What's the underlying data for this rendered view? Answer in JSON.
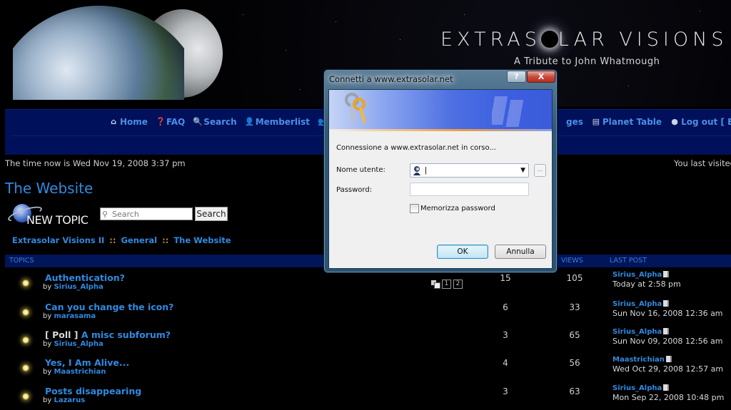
{
  "header": {
    "site_title_before": "EXTRAS",
    "site_title_after": "LAR VISIONS II",
    "subtitle": "A Tribute to John Whatmough"
  },
  "nav": {
    "left_items": [
      {
        "label": "Home",
        "icon": "home-icon"
      },
      {
        "label": "FAQ",
        "icon": "faq-icon"
      },
      {
        "label": "Search",
        "icon": "search-icon"
      },
      {
        "label": "Memberlist",
        "icon": "memberlist-icon"
      }
    ],
    "right_items": [
      {
        "label": "ges",
        "icon": ""
      },
      {
        "label": "Planet Table",
        "icon": "table-icon"
      },
      {
        "label": "Log out [ Eda",
        "icon": "logout-icon"
      }
    ]
  },
  "status": {
    "time_now": "The time now is Wed Nov 19, 2008 3:37 pm",
    "last_visit": "You last visited"
  },
  "forum": {
    "title": "The Website",
    "new_topic_label": "NEW TOPIC",
    "search_placeholder": "Search",
    "search_button": "Search",
    "breadcrumb": [
      "Extrasolar Visions II",
      "General",
      "The Website"
    ],
    "breadcrumb_sep": "::"
  },
  "table": {
    "headers": {
      "topics": "TOPICS",
      "views": "VIEWS",
      "last_post": "LAST POST"
    },
    "rows": [
      {
        "prefix": "",
        "title": "Authentication?",
        "by_label": "by",
        "author": "Sirius_Alpha",
        "pages": [
          "1",
          "2"
        ],
        "replies": "15",
        "views": "105",
        "last_user": "Sirius_Alpha",
        "last_date": "Today at 2:58 pm"
      },
      {
        "prefix": "",
        "title": "Can you change the icon?",
        "by_label": "by",
        "author": "marasama",
        "pages": [],
        "replies": "6",
        "views": "33",
        "last_user": "Sirius_Alpha",
        "last_date": "Sun Nov 16, 2008 12:36 am"
      },
      {
        "prefix": "[ Poll ]",
        "title": "A misc subforum?",
        "by_label": "by",
        "author": "Sirius_Alpha",
        "pages": [],
        "replies": "3",
        "views": "65",
        "last_user": "Sirius_Alpha",
        "last_date": "Sun Nov 09, 2008 12:56 am"
      },
      {
        "prefix": "",
        "title": "Yes, I Am Alive...",
        "by_label": "by",
        "author": "Maastrichian",
        "pages": [],
        "replies": "4",
        "views": "56",
        "last_user": "Maastrichian",
        "last_date": "Wed Oct 29, 2008 12:57 am"
      },
      {
        "prefix": "",
        "title": "Posts disappearing",
        "by_label": "by",
        "author": "Lazarus",
        "pages": [],
        "replies": "3",
        "views": "63",
        "last_user": "Sirius_Alpha",
        "last_date": "Mon Sep 22, 2008 10:48 pm"
      }
    ]
  },
  "dialog": {
    "title": "Connetti a www.extrasolar.net",
    "help_label": "?",
    "close_label": "X",
    "message": "Connessione a www.extrasolar.net in corso...",
    "username_label": "Nome utente:",
    "username_value": "|",
    "password_label": "Password:",
    "password_value": "",
    "browse_label": "...",
    "remember_label": "Memorizza password",
    "remember_checked": false,
    "ok_label": "OK",
    "cancel_label": "Annulla"
  }
}
